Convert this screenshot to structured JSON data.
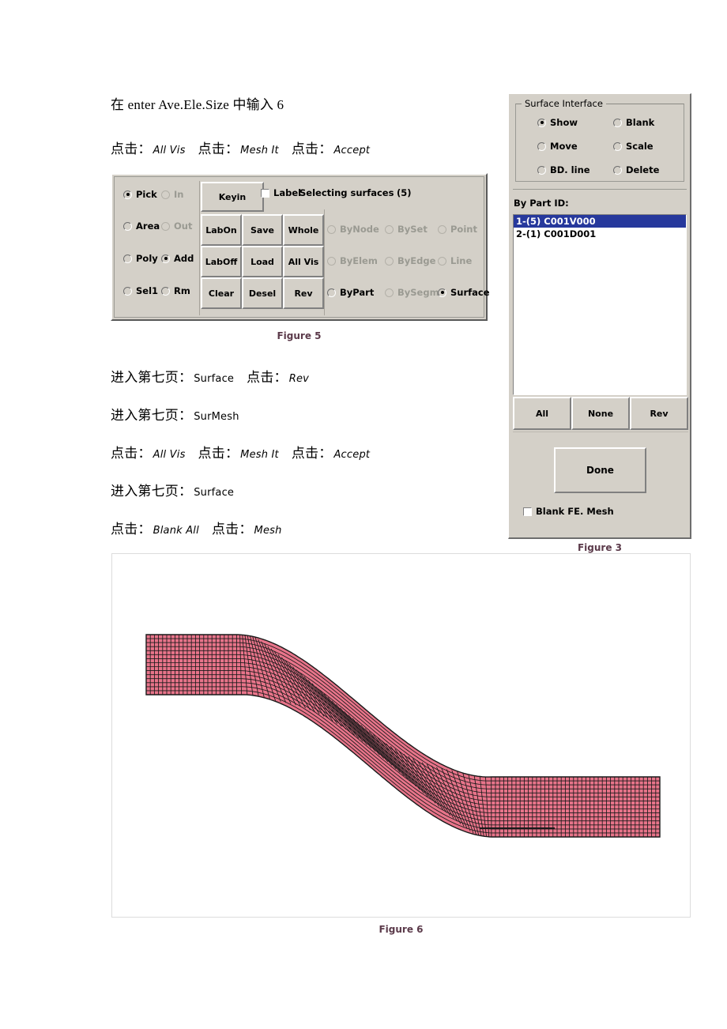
{
  "document": {
    "lines": [
      {
        "id": "line1",
        "parts": [
          {
            "t": "cjk",
            "v": "在"
          },
          {
            "t": "lat",
            "v": " enter Ave.Ele.Size "
          },
          {
            "t": "cjk",
            "v": "中输入"
          },
          {
            "t": "lat",
            "v": " 6"
          }
        ]
      },
      {
        "id": "line2",
        "parts": [
          {
            "t": "cjk",
            "v": "点击："
          },
          {
            "t": "ui",
            "v": "All Vis"
          },
          {
            "t": "gap",
            "v": ""
          },
          {
            "t": "cjk",
            "v": "点击："
          },
          {
            "t": "ui",
            "v": "Mesh It"
          },
          {
            "t": "gap",
            "v": ""
          },
          {
            "t": "cjk",
            "v": "点击："
          },
          {
            "t": "ui",
            "v": "Accept"
          }
        ]
      },
      {
        "id": "line3",
        "parts": [
          {
            "t": "cjk",
            "v": "进入第七页："
          },
          {
            "t": "uin",
            "v": "Surface"
          },
          {
            "t": "gap",
            "v": ""
          },
          {
            "t": "cjk",
            "v": "点击："
          },
          {
            "t": "ui",
            "v": "Rev"
          }
        ]
      },
      {
        "id": "line4",
        "parts": [
          {
            "t": "cjk",
            "v": "进入第七页："
          },
          {
            "t": "uin",
            "v": "SurMesh"
          }
        ]
      },
      {
        "id": "line5",
        "parts": [
          {
            "t": "cjk",
            "v": "点击："
          },
          {
            "t": "ui",
            "v": "All Vis"
          },
          {
            "t": "gap",
            "v": ""
          },
          {
            "t": "cjk",
            "v": "点击："
          },
          {
            "t": "ui",
            "v": "Mesh It"
          },
          {
            "t": "gap",
            "v": ""
          },
          {
            "t": "cjk",
            "v": "点击："
          },
          {
            "t": "ui",
            "v": "Accept"
          }
        ]
      },
      {
        "id": "line6",
        "parts": [
          {
            "t": "cjk",
            "v": "进入第七页："
          },
          {
            "t": "uin",
            "v": "Surface"
          }
        ]
      },
      {
        "id": "line7",
        "parts": [
          {
            "t": "cjk",
            "v": "点击："
          },
          {
            "t": "ui",
            "v": "Blank All"
          },
          {
            "t": "gap",
            "v": ""
          },
          {
            "t": "cjk",
            "v": "点击："
          },
          {
            "t": "ui",
            "v": "Mesh"
          }
        ]
      }
    ]
  },
  "figure5": {
    "caption": "Figure 5",
    "status_label": "Selecting surfaces",
    "status_count": "(5)",
    "label_checkbox": "Label",
    "label_checked": false,
    "mode_radios_left": [
      {
        "label": "Pick",
        "selected": true,
        "disabled": false
      },
      {
        "label": "Area",
        "selected": false,
        "disabled": false
      },
      {
        "label": "Poly",
        "selected": false,
        "disabled": false
      },
      {
        "label": "Sel1",
        "selected": false,
        "disabled": false
      }
    ],
    "mode_radios_right": [
      {
        "label": "In",
        "selected": false,
        "disabled": true
      },
      {
        "label": "Out",
        "selected": false,
        "disabled": true
      },
      {
        "label": "Add",
        "selected": true,
        "disabled": false
      },
      {
        "label": "Rm",
        "selected": false,
        "disabled": false
      }
    ],
    "keyin_button": "Keyin",
    "buttons_grid": [
      [
        "LabOn",
        "Save",
        "Whole"
      ],
      [
        "LabOff",
        "Load",
        "All Vis"
      ],
      [
        "Clear",
        "Desel",
        "Rev"
      ]
    ],
    "entity_radios": [
      [
        {
          "label": "ByNode",
          "selected": false,
          "disabled": true
        },
        {
          "label": "BySet",
          "selected": false,
          "disabled": true
        },
        {
          "label": "Point",
          "selected": false,
          "disabled": true
        }
      ],
      [
        {
          "label": "ByElem",
          "selected": false,
          "disabled": true
        },
        {
          "label": "ByEdge",
          "selected": false,
          "disabled": true
        },
        {
          "label": "Line",
          "selected": false,
          "disabled": true
        }
      ],
      [
        {
          "label": "ByPart",
          "selected": false,
          "disabled": false
        },
        {
          "label": "BySegm",
          "selected": false,
          "disabled": true
        },
        {
          "label": "Surface",
          "selected": true,
          "disabled": false
        }
      ]
    ]
  },
  "figure3": {
    "caption": "Figure 3",
    "group_title": "Surface Interface",
    "ops_radios": [
      {
        "label": "Show",
        "selected": true
      },
      {
        "label": "Blank",
        "selected": false
      },
      {
        "label": "Move",
        "selected": false
      },
      {
        "label": "Scale",
        "selected": false
      },
      {
        "label": "BD. line",
        "selected": false
      },
      {
        "label": "Delete",
        "selected": false
      }
    ],
    "list_label": "By Part ID:",
    "list_items": [
      {
        "text": "1-(5) C001V000",
        "selected": true
      },
      {
        "text": "2-(1) C001D001",
        "selected": false
      }
    ],
    "select_buttons": [
      "All",
      "None",
      "Rev"
    ],
    "done_button": "Done",
    "blank_fe_mesh": "Blank FE. Mesh",
    "blank_fe_mesh_checked": false
  },
  "figure6": {
    "caption": "Figure 6",
    "mesh_color": "#e8748a",
    "mesh_line_color": "#1a1a1a",
    "background": "#ffffff"
  },
  "colors": {
    "dialog_face": "#d4d0c8",
    "caption_text": "#5b3a4a",
    "list_select": "#26389c",
    "mesh_fill": "#e8748a"
  }
}
